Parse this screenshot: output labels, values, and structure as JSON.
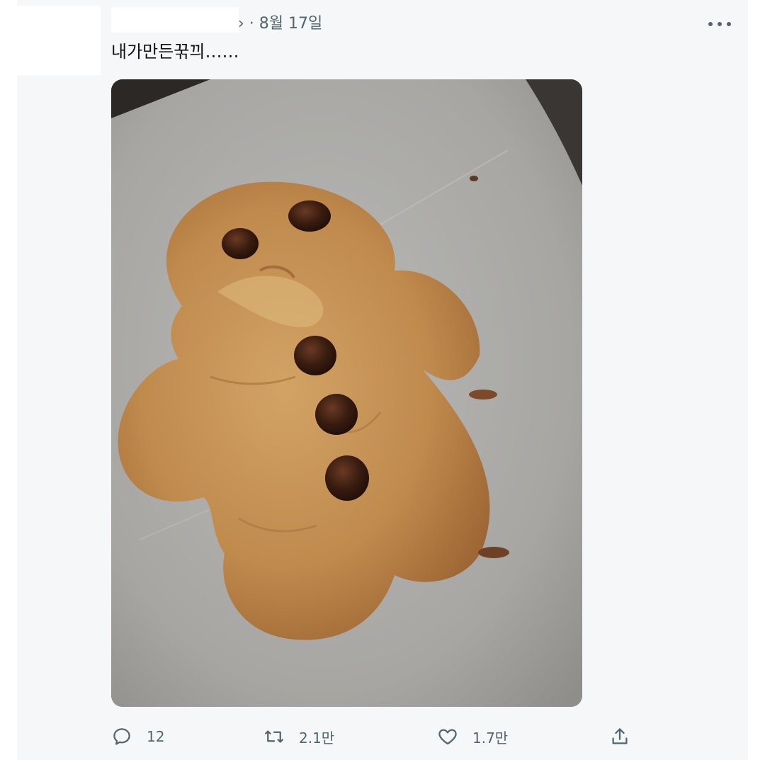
{
  "tweet": {
    "meta": "› · 8월 17일",
    "text": "내가만든꾺끠……",
    "more_icon": "more-horizontal-icon"
  },
  "photo": {
    "subject": "gingerbread-shaped chocolate chip cookie on baking paper"
  },
  "actions": {
    "reply": {
      "icon": "reply-icon",
      "count": "12"
    },
    "retweet": {
      "icon": "retweet-icon",
      "count": "2.1만"
    },
    "like": {
      "icon": "heart-icon",
      "count": "1.7만"
    },
    "share": {
      "icon": "share-icon"
    }
  },
  "colors": {
    "text": "#0f1419",
    "secondary": "#536471",
    "card_bg": "#f6f7f8"
  }
}
